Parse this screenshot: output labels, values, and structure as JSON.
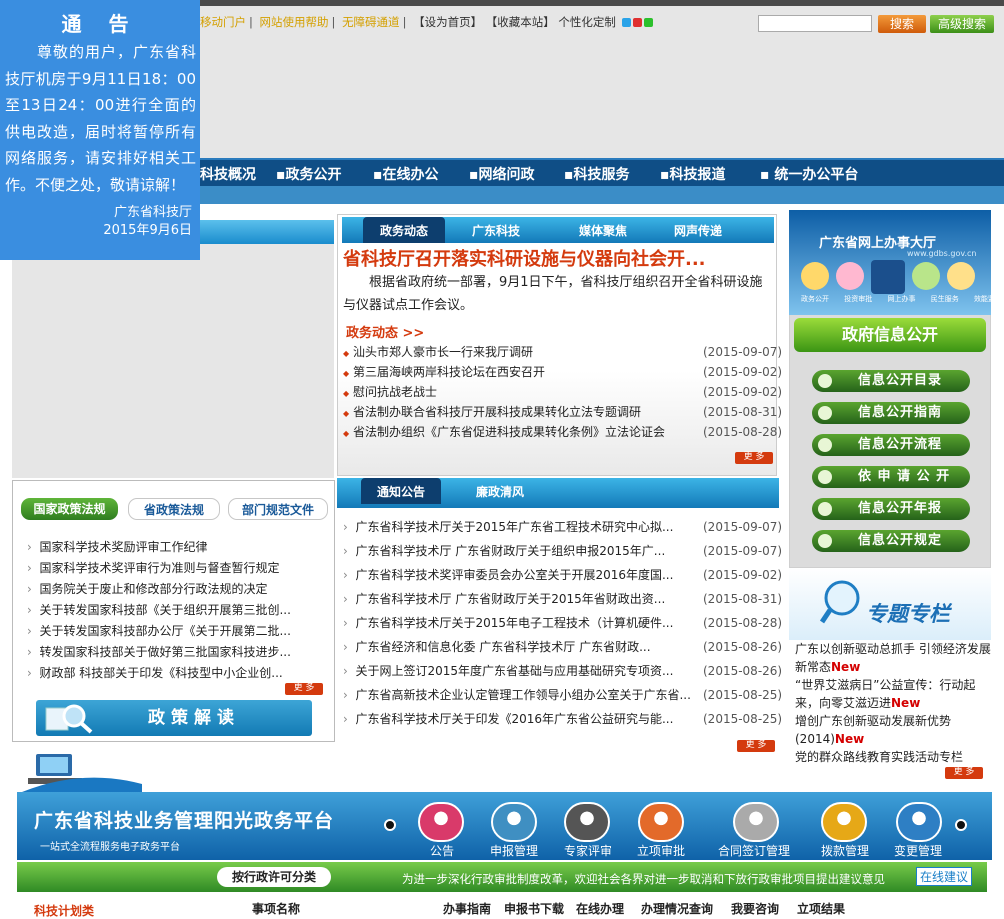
{
  "notice": {
    "title": "通 告",
    "body": "尊敬的用户，广东省科技厅机房于9月11日18：00至13日24：00进行全面的供电改造，届时将暂停所有网络服务，请安排好相关工作。不便之处，敬请谅解！",
    "org": "广东省科技厅",
    "date": "2015年9月6日"
  },
  "toplinks": {
    "mobile": "移动门户",
    "help": "网站使用帮助",
    "accessible": "无障碍通道",
    "homepage": "【设为首页】",
    "favorite": "【收藏本站】",
    "custom": "个性化定制",
    "search_button": "搜索",
    "advanced_button": "高级搜索"
  },
  "nav": [
    "科技概况",
    "政务公开",
    "在线办公",
    "网络问政",
    "科技服务",
    "科技报道",
    "统一办公平台"
  ],
  "news": {
    "tabs": [
      "政务动态",
      "广东科技",
      "媒体聚焦",
      "网声传递"
    ],
    "headline": "省科技厅召开落实科研设施与仪器向社会开...",
    "summary": "根据省政府统一部署，9月1日下午，省科技厅组织召开全省科研设施与仪器试点工作会议。",
    "section": "政务动态 >>",
    "items": [
      {
        "title": "汕头市郑人豪市长一行来我厅调研",
        "date": "(2015-09-07)"
      },
      {
        "title": "第三届海峡两岸科技论坛在西安召开",
        "date": "(2015-09-02)"
      },
      {
        "title": "慰问抗战老战士",
        "date": "(2015-09-02)"
      },
      {
        "title": "省法制办联合省科技厅开展科技成果转化立法专题调研",
        "date": "(2015-08-31)"
      },
      {
        "title": "省法制办组织《广东省促进科技成果转化条例》立法论证会",
        "date": "(2015-08-28)"
      }
    ],
    "more": "更 多"
  },
  "notices": {
    "tabs": [
      "通知公告",
      "廉政清风"
    ],
    "items": [
      {
        "title": "广东省科学技术厅关于2015年广东省工程技术研究中心拟...",
        "date": "(2015-09-07)"
      },
      {
        "title": "广东省科学技术厅 广东省财政厅关于组织申报2015年广...",
        "date": "(2015-09-07)"
      },
      {
        "title": "广东省科学技术奖评审委员会办公室关于开展2016年度国...",
        "date": "(2015-09-02)"
      },
      {
        "title": "广东省科学技术厅 广东省财政厅关于2015年省财政出资...",
        "date": "(2015-08-31)"
      },
      {
        "title": "广东省科学技术厅关于2015年电子工程技术（计算机硬件...",
        "date": "(2015-08-28)"
      },
      {
        "title": "广东省经济和信息化委 广东省科学技术厅 广东省财政...",
        "date": "(2015-08-26)"
      },
      {
        "title": "关于网上签订2015年度广东省基础与应用基础研究专项资...",
        "date": "(2015-08-26)"
      },
      {
        "title": "广东省高新技术企业认定管理工作领导小组办公室关于广东省...",
        "date": "(2015-08-25)"
      },
      {
        "title": "广东省科学技术厅关于印发《2016年广东省公益研究与能...",
        "date": "(2015-08-25)"
      }
    ],
    "more": "更 多"
  },
  "policy": {
    "tabs": [
      "国家政策法规",
      "省政策法规",
      "部门规范文件"
    ],
    "items": [
      "国家科学技术奖励评审工作纪律",
      "国家科学技术奖评审行为准则与督查暂行规定",
      "国务院关于废止和修改部分行政法规的决定",
      "关于转发国家科技部《关于组织开展第三批创...",
      "关于转发国家科技部办公厅《关于开展第二批...",
      "转发国家科技部关于做好第三批国家科技进步...",
      "财政部 科技部关于印发《科技型中小企业创..."
    ],
    "more": "更 多",
    "interpret": "政策解读"
  },
  "right": {
    "hall": "广东省网上办事大厅",
    "hall_url": "www.gdbs.gov.cn",
    "hall_icons": [
      "政务公开",
      "投资审批",
      "网上办事",
      "民生服务",
      "效能监察"
    ],
    "info_header": "政府信息公开",
    "info_buttons": [
      "信息公开目录",
      "信息公开指南",
      "信息公开流程",
      "依 申 请 公 开",
      "信息公开年报",
      "信息公开规定"
    ],
    "topic_label": "专题专栏",
    "topics": [
      {
        "text": "广东以创新驱动总抓手 引领经济发展新常态",
        "new": "New"
      },
      {
        "text": "“世界艾滋病日”公益宣传：行动起来，向零艾滋迈进",
        "new": "New"
      },
      {
        "text": "增创广东创新驱动发展新优势(2014)",
        "new": "New"
      },
      {
        "text": "党的群众路线教育实践活动专栏",
        "new": ""
      }
    ],
    "more": "更 多"
  },
  "platform": {
    "title": "广东省科技业务管理阳光政务平台",
    "subtitle": "一站式全流程服务电子政务平台",
    "items": [
      "公告",
      "申报管理",
      "专家评审",
      "立项审批",
      "合同签订管理",
      "拨款管理",
      "变更管理"
    ],
    "icon_colors": [
      "#d93a6a",
      "#3f8fc2",
      "#555555",
      "#e36a2a",
      "#aaaaaa",
      "#e6a817",
      "#2e7fc4"
    ]
  },
  "approval": {
    "tag": "按行政许可分类",
    "text": "为进一步深化行政审批制度改革，欢迎社会各界对进一步取消和下放行政审批项目提出建议意见",
    "button": "在线建议",
    "category": "科技计划类",
    "columns": [
      "事项名称",
      "办事指南",
      "申报书下载",
      "在线办理",
      "办理情况查询",
      "我要咨询",
      "立项结果"
    ]
  },
  "colors": {
    "accent_red": "#d43a0e",
    "nav_blue": "#0f4e86",
    "green": "#3b9514"
  }
}
